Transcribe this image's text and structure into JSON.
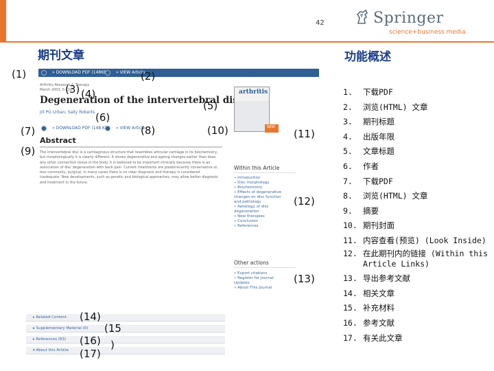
{
  "header": {
    "page_number": "42",
    "brand": "Springer",
    "tagline": "science+business media"
  },
  "left_title": "期刊文章",
  "right_title": "功能概述",
  "screenshot": {
    "download_pdf_1": "» DOWNLOAD PDF (148KB)",
    "view_article_1": "» VIEW Article",
    "download_pdf_2": "» DOWNLOAD PDF (148 KB)",
    "view_article_2": "» VIEW Article",
    "meta_line_1": "Arthritis Research & Therapy",
    "meta_line_2": "March 2003, 5:120",
    "article_title": "Degeneration of the intervertebral disc",
    "authors": "Jill PG Urban, Sally Roberts",
    "abstract_heading": "Abstract",
    "abstract_text": "The intervertebral disc is a cartilaginous structure that resembles articular cartilage in its biochemistry, but morphologically it is clearly different. It shows degenerative and ageing changes earlier than does any other connective tissue in the body. It is believed to be important clinically because there is an association of disc degeneration with back pain. Current treatments are predominantly conservative or, less commonly, surgical; in many cases there is no clear diagnosis and therapy is considered inadequate. New developments, such as genetic and biological approaches, may allow better diagnosis and treatment in the future.",
    "cover_title": "arthritis",
    "cover_badge": "NEW",
    "within_article_heading": "Within this Article",
    "within_article_links": [
      "» Introduction",
      "» Disc morphology",
      "» Biochemistry",
      "» Effects of degenerative",
      "  changes on disc function",
      "  and pathology",
      "» Aetiology of disc",
      "  degeneration",
      "» New therapies",
      "» Conclusion",
      "» References"
    ],
    "other_actions_heading": "Other actions",
    "other_actions_links": [
      "» Export citations",
      "» Register for Journal",
      "  Updates",
      "» About This Journal"
    ],
    "accordion": [
      "▸ Related Content",
      "▸ Supplementary Material (0)",
      "▸ References (63)",
      "▾ About this Article"
    ]
  },
  "callouts": [
    "(1)",
    "(2)",
    "(3)",
    "(4)",
    "(5)",
    "(6)",
    "(7)",
    "(8)",
    "(9)",
    "(10)",
    "(11)",
    "(12)",
    "(13)",
    "(14)",
    "(15",
    ")",
    "(16)",
    "(17)"
  ],
  "features": [
    {
      "num": "1.",
      "text": "下载PDF"
    },
    {
      "num": "2.",
      "text": "浏览(HTML) 文章"
    },
    {
      "num": "3.",
      "text": "期刊标题"
    },
    {
      "num": "4.",
      "text": "出版年限"
    },
    {
      "num": "5.",
      "text": "文章标题"
    },
    {
      "num": "6.",
      "text": "作者"
    },
    {
      "num": "7.",
      "text": "下载PDF"
    },
    {
      "num": "8.",
      "text": "浏览(HTML) 文章"
    },
    {
      "num": "9.",
      "text": "摘要"
    },
    {
      "num": "10.",
      "text": "期刊封面"
    },
    {
      "num": "11.",
      "text": "内容查看(预览) (Look Inside)"
    },
    {
      "num": "12.",
      "text": "在此期刊内的链接 (Within this Article Links)"
    },
    {
      "num": "13.",
      "text": "导出参考文献"
    },
    {
      "num": "14.",
      "text": "相关文章"
    },
    {
      "num": "15.",
      "text": "补充材料"
    },
    {
      "num": "16.",
      "text": "参考文献"
    },
    {
      "num": "17.",
      "text": "有关此文章"
    }
  ],
  "colors": {
    "accent_orange": "#e8772e",
    "title_blue": "#1b3e8a",
    "link_blue": "#3a6aa0",
    "button_blue": "#2f5f94"
  }
}
